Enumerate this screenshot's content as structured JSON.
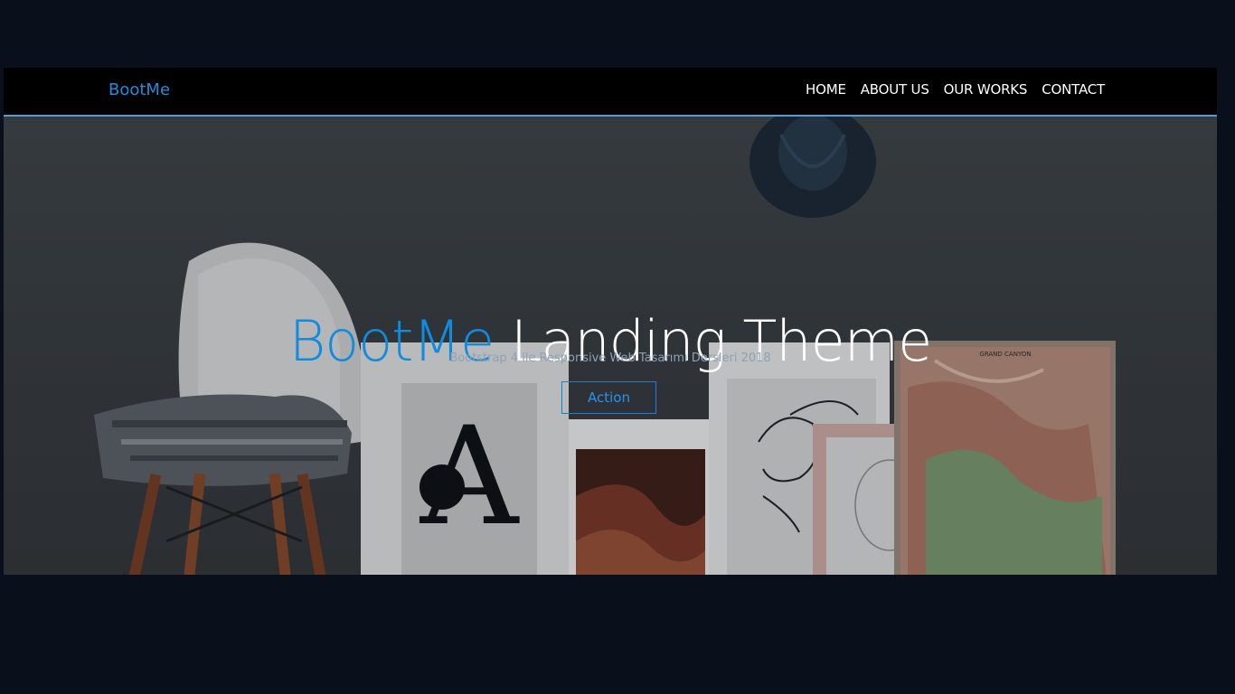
{
  "navbar": {
    "brand": "BootMe",
    "links": [
      {
        "label": "HOME"
      },
      {
        "label": "ABOUT US"
      },
      {
        "label": "OUR WORKS"
      },
      {
        "label": "CONTACT"
      }
    ]
  },
  "hero": {
    "title_accent": "BootMe",
    "title_rest": " Landing Theme",
    "subtitle": "Bootstrap 4 ile Responsive Web Tasarımı Dersleri 2018",
    "action_label": "Action",
    "framed_letter": "A",
    "map_caption": "GRAND CANYON"
  },
  "colors": {
    "page_bg": "#0a101b",
    "navbar_bg": "#000000",
    "navbar_border": "#4f9fd6",
    "accent": "#0f8be0",
    "button_border": "#1f7fd8"
  }
}
